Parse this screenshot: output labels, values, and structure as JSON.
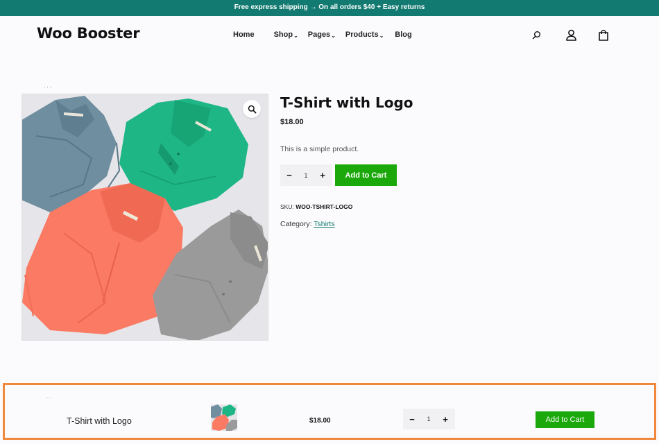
{
  "promo_bar": {
    "text": "Free express shipping → On all orders $40 + Easy returns"
  },
  "header": {
    "logo": "Woo Booster",
    "nav": [
      {
        "label": "Home",
        "dropdown": false
      },
      {
        "label": "Shop",
        "dropdown": true
      },
      {
        "label": "Pages",
        "dropdown": true
      },
      {
        "label": "Products",
        "dropdown": true
      },
      {
        "label": "Blog",
        "dropdown": false
      }
    ],
    "icons": [
      "search-icon",
      "user-icon",
      "bag-icon"
    ]
  },
  "breadcrumb": {
    "text": ". . ."
  },
  "product": {
    "title": "T-Shirt with Logo",
    "price": "$18.00",
    "description": "This is a simple product.",
    "quantity": "1",
    "add_to_cart": "Add to Cart",
    "sku_label": "SKU:",
    "sku_value": "WOO-TSHIRT-LOGO",
    "category_label": "Category:",
    "category_value": "Tshirts"
  },
  "sticky_bar": {
    "title": "T-Shirt with Logo",
    "price": "$18.00",
    "quantity": "1",
    "add_to_cart": "Add to Cart",
    "dots": ". ."
  },
  "colors": {
    "promo_bg": "#127a70",
    "button_green": "#1aa80a",
    "highlight_border": "#f0883e",
    "shirt_blue": "#6f8ea0",
    "shirt_green": "#1fb686",
    "shirt_coral": "#fa7a63",
    "shirt_gray": "#9a9a9a"
  }
}
